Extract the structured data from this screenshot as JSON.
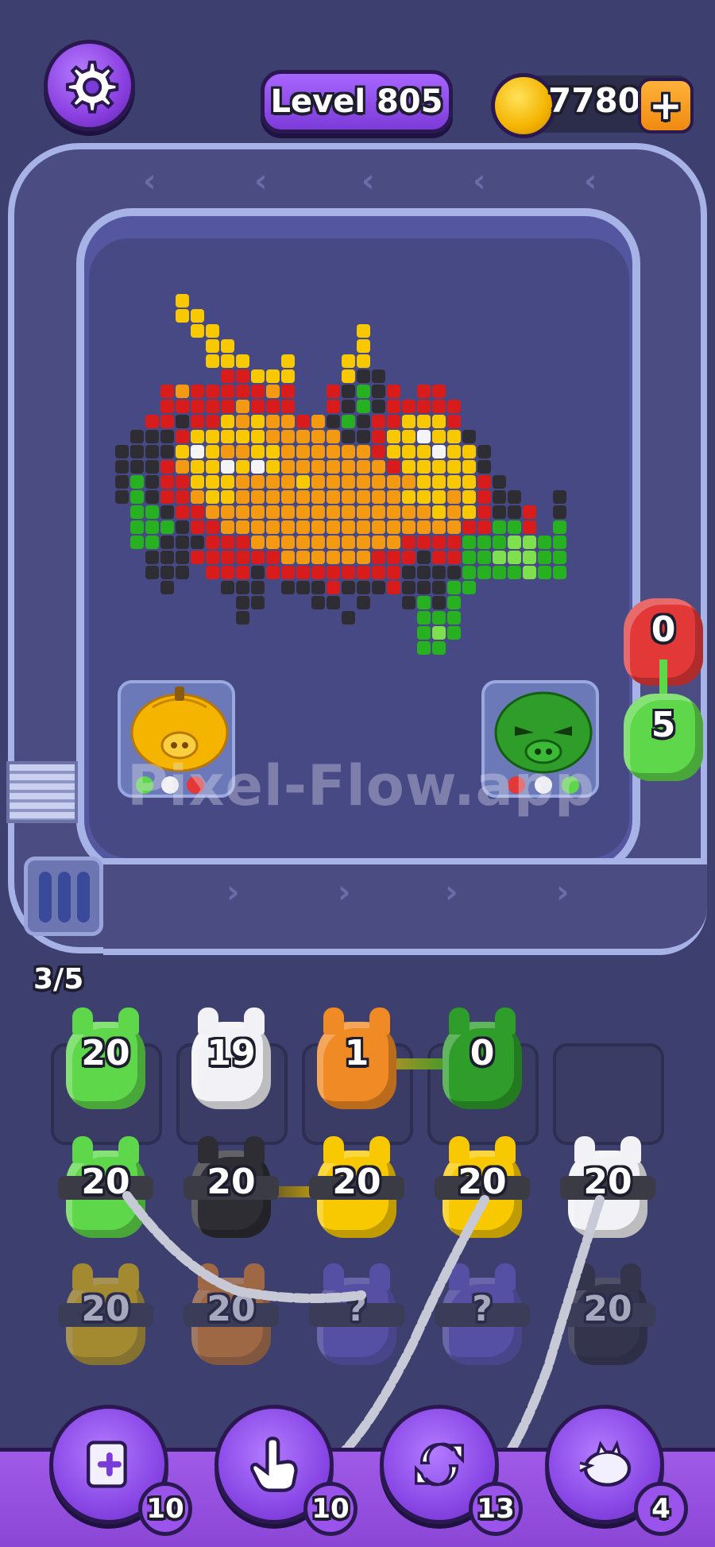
{
  "header": {
    "level_label": "Level 805",
    "coins": "7780",
    "plus_symbol": "+"
  },
  "watermark": "Pixel-Flow.app",
  "progress": "3/5",
  "side_stack": [
    {
      "color": "#e23838",
      "count": "0"
    },
    {
      "color": "#5ed74a",
      "count": "5"
    }
  ],
  "board_pigs": [
    {
      "name": "pumpkin-pig",
      "color": "#f5b400"
    },
    {
      "name": "green-angry-pig",
      "color": "#2e9d2a"
    }
  ],
  "grid": {
    "row1": [
      {
        "color": "#5ed74a",
        "count": "20"
      },
      {
        "color": "#f2f2f6",
        "count": "19"
      },
      {
        "color": "#f08a24",
        "count": "1"
      },
      {
        "color": "#2e9d2a",
        "count": "0"
      }
    ],
    "row2": [
      {
        "color": "#5ed74a",
        "count": "20"
      },
      {
        "color": "#2d2d33",
        "count": "20"
      },
      {
        "color": "#f8c800",
        "count": "20"
      },
      {
        "color": "#f8c800",
        "count": "20"
      },
      {
        "color": "#f2f2f6",
        "count": "20"
      }
    ],
    "row3": [
      {
        "color": "#f8c800",
        "count": "20"
      },
      {
        "color": "#f08a24",
        "count": "20"
      },
      {
        "color": "#6a5fd0",
        "count": "?"
      },
      {
        "color": "#6a5fd0",
        "count": "?"
      },
      {
        "color": "#2d2d33",
        "count": "20"
      }
    ]
  },
  "tools": [
    {
      "name": "add-slot",
      "count": "10"
    },
    {
      "name": "hand",
      "count": "10"
    },
    {
      "name": "shuffle",
      "count": "13"
    },
    {
      "name": "ghost-pig",
      "count": "4"
    }
  ]
}
